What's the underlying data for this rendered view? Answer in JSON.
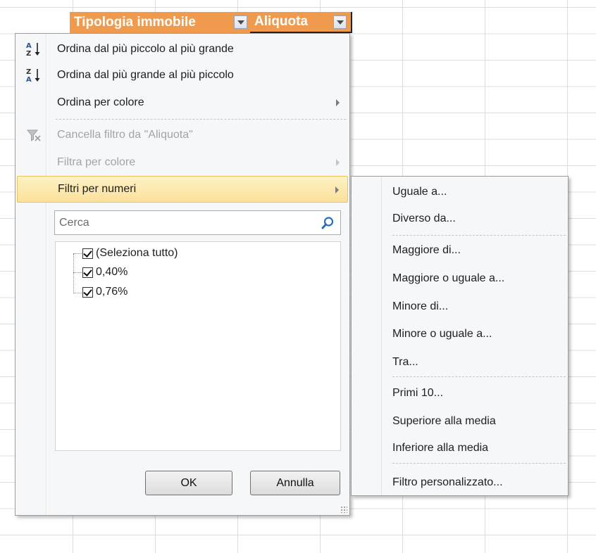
{
  "header": {
    "col1_title": "Tipologia immobile",
    "col2_title": "Aliquota"
  },
  "colors": {
    "header_bg": "#f09a4e",
    "hot_item_bg": "#fbe09a",
    "menu_bg": "#f6f7f9"
  },
  "menu": {
    "sort_asc": "Ordina dal più piccolo al più grande",
    "sort_desc": "Ordina dal più grande al più piccolo",
    "sort_color": "Ordina per colore",
    "clear_filter": "Cancella filtro da \"Aliquota\"",
    "filter_color": "Filtra per colore",
    "number_filters": "Filtri per numeri"
  },
  "search": {
    "placeholder": "Cerca"
  },
  "tree": {
    "items": [
      "(Seleziona tutto)",
      "0,40%",
      "0,76%"
    ]
  },
  "buttons": {
    "ok": "OK",
    "cancel": "Annulla"
  },
  "submenu": {
    "equal": "Uguale a...",
    "not_equal": "Diverso da...",
    "greater": "Maggiore di...",
    "greater_equal": "Maggiore o uguale a...",
    "less": "Minore di...",
    "less_equal": "Minore o uguale a...",
    "between": "Tra...",
    "top10": "Primi 10...",
    "above_avg": "Superiore alla media",
    "below_avg": "Inferiore alla media",
    "custom": "Filtro personalizzato..."
  }
}
